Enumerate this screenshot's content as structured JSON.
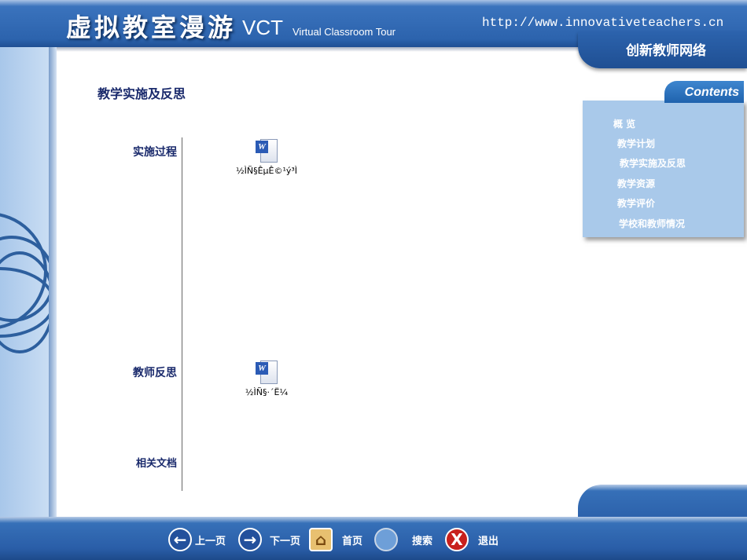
{
  "header": {
    "title_cn": "虚拟教室漫游",
    "title_abbr": "VCT",
    "title_en": "Virtual Classroom Tour",
    "url": "http://www.innovativeteachers.cn",
    "org": "创新教师网络"
  },
  "page_title": "教学实施及反思",
  "sections": [
    {
      "label": "实施过程",
      "doc": {
        "name": "½ÌÑ§ÊµÊ©¹ý³Ì",
        "icon": "word-doc-icon"
      }
    },
    {
      "label": "教师反思",
      "doc": {
        "name": "½ÌÑ§·´Ë¼",
        "icon": "word-doc-icon"
      }
    },
    {
      "label": "相关文档"
    }
  ],
  "contents": {
    "title": "Contents",
    "items": [
      "概 览",
      "教学计划",
      "教学实施及反思",
      "教学资源",
      "教学评价",
      "学校和教师情况"
    ]
  },
  "footer": {
    "prev": "上一页",
    "next": "下一页",
    "home": "首页",
    "search": "搜索",
    "exit": "退出"
  }
}
